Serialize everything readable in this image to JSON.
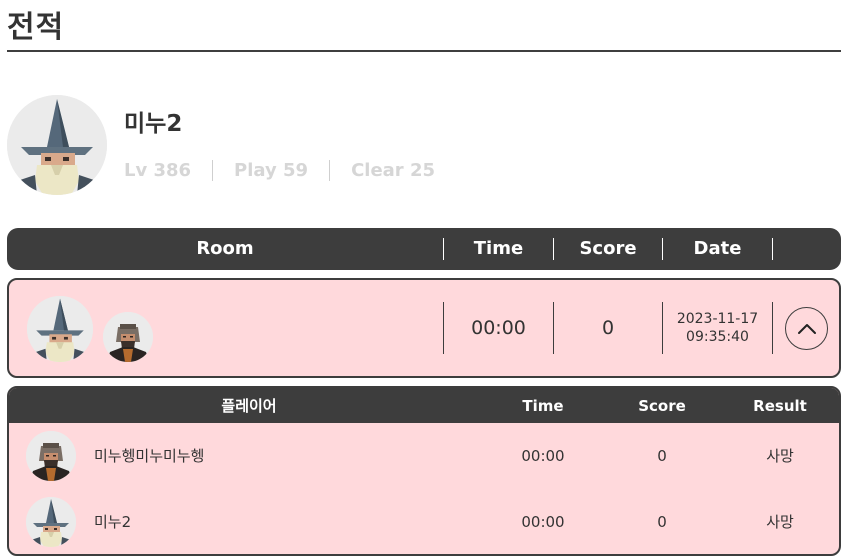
{
  "page": {
    "title": "전적"
  },
  "profile": {
    "name": "미누2",
    "avatar_icon": "wizard-avatar",
    "stats": [
      "Lv 386",
      "Play 59",
      "Clear 25"
    ]
  },
  "table": {
    "headers": {
      "room": "Room",
      "time": "Time",
      "score": "Score",
      "date": "Date"
    }
  },
  "room": {
    "avatars": [
      "wizard-avatar",
      "knight-avatar"
    ],
    "time": "00:00",
    "score": "0",
    "date": "2023-11-17",
    "clock": "09:35:40",
    "toggle_icon": "chevron-up-icon"
  },
  "detail": {
    "headers": {
      "player": "플레이어",
      "time": "Time",
      "score": "Score",
      "result": "Result"
    },
    "players": [
      {
        "avatar": "knight-avatar",
        "name": "미누헹미누미누헹",
        "time": "00:00",
        "score": "0",
        "result": "사망"
      },
      {
        "avatar": "wizard-avatar",
        "name": "미누2",
        "time": "00:00",
        "score": "0",
        "result": "사망"
      }
    ]
  },
  "colors": {
    "header_bg": "#3d3d3d",
    "row_bg": "#ffd9dc",
    "stat_text": "#d6d6d6",
    "hat": "#5f7180",
    "beard": "#ece7c6"
  }
}
